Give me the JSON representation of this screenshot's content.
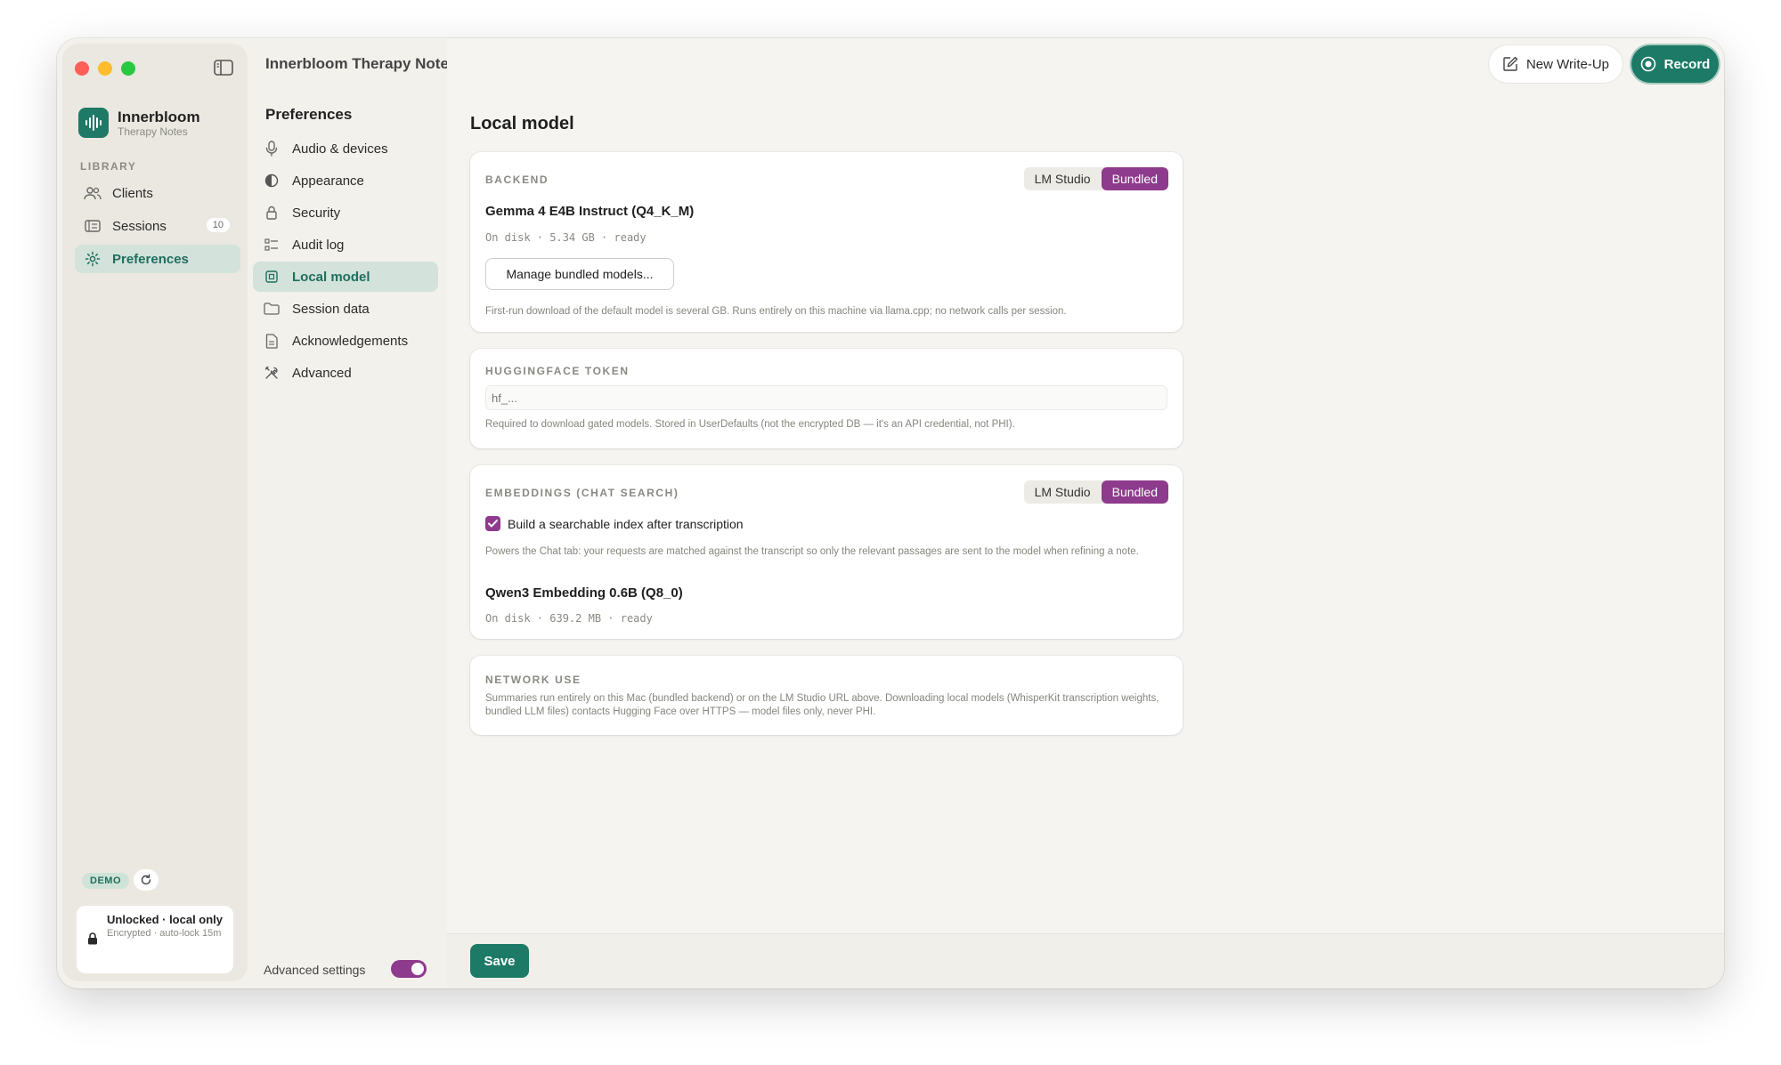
{
  "window": {
    "title": "Innerbloom Therapy Notes"
  },
  "brand": {
    "title": "Innerbloom",
    "subtitle": "Therapy Notes",
    "accent_color": "#1d7a66",
    "highlight_color": "#8e3a8d"
  },
  "sidebar": {
    "section_label": "LIBRARY",
    "items": [
      {
        "label": "Clients",
        "icon": "people-icon"
      },
      {
        "label": "Sessions",
        "icon": "list-icon",
        "badge": "10"
      },
      {
        "label": "Preferences",
        "icon": "gear-icon",
        "active": true
      }
    ],
    "demo_badge": "DEMO",
    "lock_status": {
      "title": "Unlocked · local only",
      "subtitle": "Encrypted · auto-lock 15m"
    }
  },
  "header": {
    "new_write_up_label": "New Write-Up",
    "record_label": "Record"
  },
  "preferences_nav": {
    "title": "Preferences",
    "items": [
      {
        "label": "Audio & devices",
        "icon": "microphone-icon"
      },
      {
        "label": "Appearance",
        "icon": "half-circle-icon"
      },
      {
        "label": "Security",
        "icon": "lock-icon"
      },
      {
        "label": "Audit log",
        "icon": "checklist-icon"
      },
      {
        "label": "Local model",
        "icon": "chip-icon",
        "active": true
      },
      {
        "label": "Session data",
        "icon": "folder-icon"
      },
      {
        "label": "Acknowledgements",
        "icon": "document-icon"
      },
      {
        "label": "Advanced",
        "icon": "tools-icon"
      }
    ],
    "advanced_settings_label": "Advanced settings",
    "advanced_settings_on": true
  },
  "main": {
    "title": "Local model",
    "backend": {
      "label": "BACKEND",
      "options": [
        "LM Studio",
        "Bundled"
      ],
      "selected": "Bundled",
      "model_name": "Gemma 4 E4B Instruct (Q4_K_M)",
      "status": "On disk · 5.34 GB · ready",
      "manage_button": "Manage bundled models...",
      "hint": "First-run download of the default model is several GB. Runs entirely on this machine via llama.cpp; no network calls per session."
    },
    "huggingface": {
      "label": "HUGGINGFACE TOKEN",
      "placeholder": "hf_...",
      "hint": "Required to download gated models. Stored in UserDefaults (not the encrypted DB — it's an API credential, not PHI)."
    },
    "embeddings": {
      "label": "EMBEDDINGS (CHAT SEARCH)",
      "options": [
        "LM Studio",
        "Bundled"
      ],
      "selected": "Bundled",
      "checkbox_label": "Build a searchable index after transcription",
      "checkbox_checked": true,
      "hint": "Powers the Chat tab: your requests are matched against the transcript so only the relevant passages are sent to the model when refining a note.",
      "model_name": "Qwen3 Embedding 0.6B (Q8_0)",
      "status": "On disk · 639.2 MB · ready"
    },
    "network": {
      "label": "NETWORK USE",
      "hint": "Summaries run entirely on this Mac (bundled backend) or on the LM Studio URL above. Downloading local models (WhisperKit transcription weights, bundled LLM files) contacts Hugging Face over HTTPS — model files only, never PHI."
    },
    "save_label": "Save"
  }
}
